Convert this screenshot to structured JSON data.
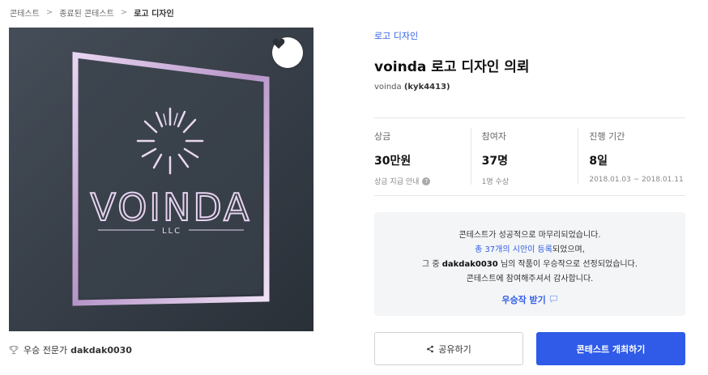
{
  "breadcrumb": {
    "items": [
      "콘테스트",
      "종료된 콘테스트",
      "로고 디자인"
    ],
    "separator": ">"
  },
  "hero": {
    "logo_wordmark": "VOINDA",
    "logo_sub": "LLC",
    "like_icon": "heart-icon"
  },
  "winner": {
    "label": "우승 전문가",
    "name": "dakdak0030",
    "icon": "trophy-icon"
  },
  "contest": {
    "category": "로고 디자인",
    "title": "voinda 로고 디자인 의뢰",
    "owner_name": "voinda",
    "owner_id": "(kyk4413)"
  },
  "stats": {
    "prize_label": "상금",
    "prize_value": "30만원",
    "prize_sub": "상금 지급 안내",
    "participants_label": "참여자",
    "participants_value": "37명",
    "participants_sub": "1명 수상",
    "period_label": "진행 기간",
    "period_value": "8일",
    "period_sub": "2018.01.03 ~ 2018.01.11"
  },
  "notice": {
    "line1": "콘테스트가 성공적으로 마무리되었습니다.",
    "line2_link": "총 37개의 시안이 등록",
    "line2_rest": "되었으며,",
    "line3_prefix": "그 중 ",
    "line3_name": "dakdak0030",
    "line3_rest": " 님의 작품이 우승작으로 선정되었습니다.",
    "line4": "콘테스트에 참여해주셔서 감사합니다.",
    "winner_link": "우승작 받기"
  },
  "actions": {
    "share_label": "공유하기",
    "host_label": "콘테스트 개최하기"
  },
  "colors": {
    "accent": "#2f5be8",
    "link": "#2f5ee8",
    "notice_bg": "#f4f5f7"
  }
}
